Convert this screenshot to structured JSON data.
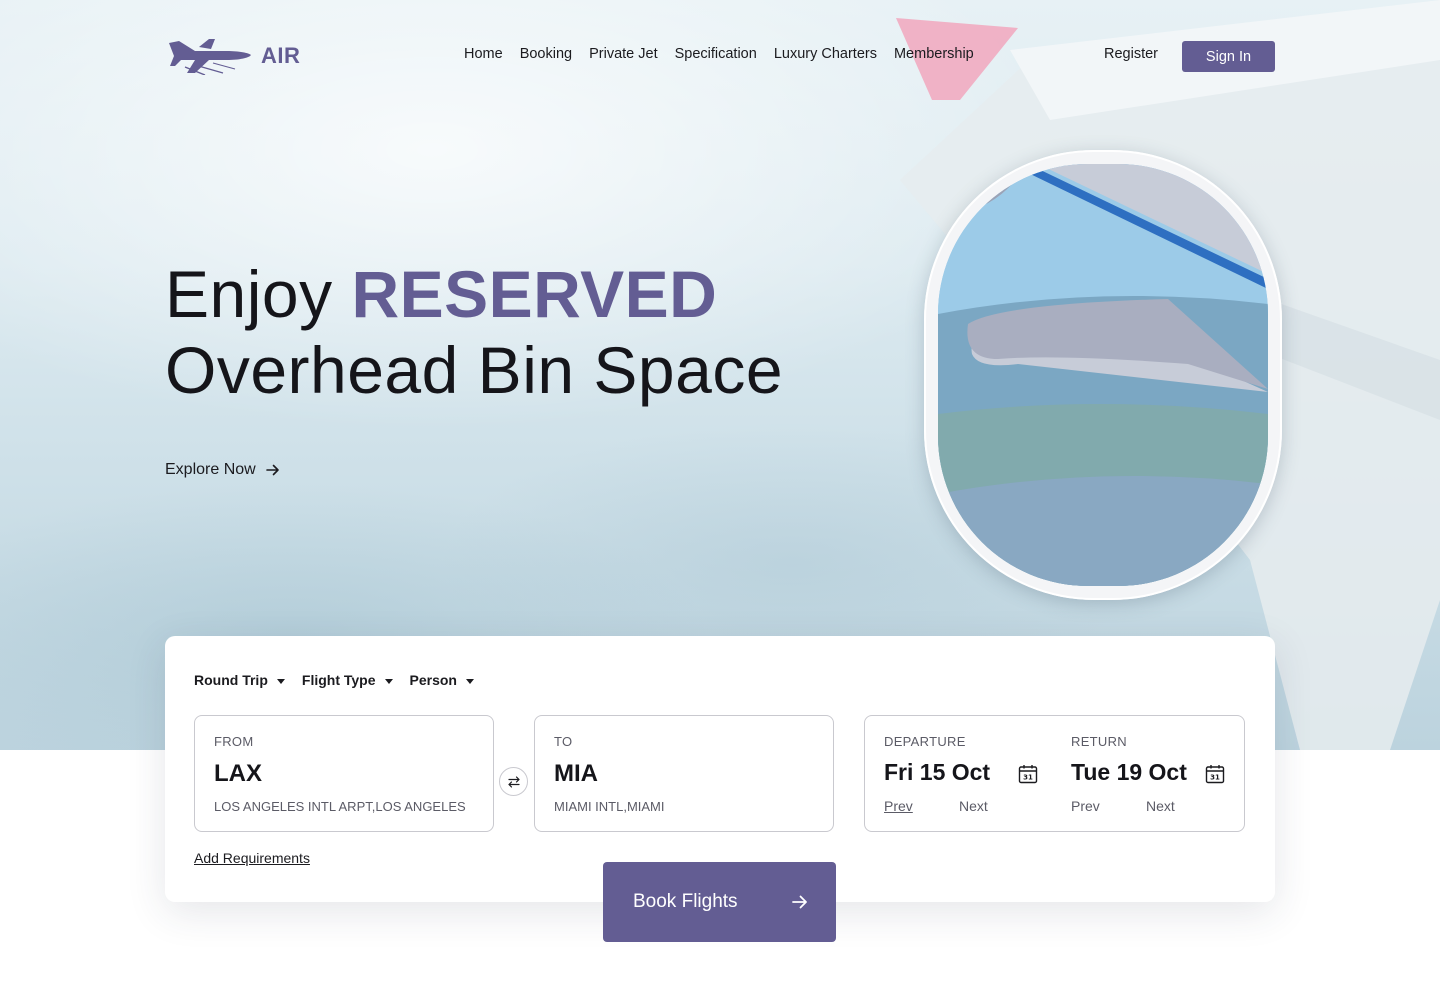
{
  "brand": {
    "name": "AIR",
    "accent": "#635d93"
  },
  "nav": {
    "items": [
      "Home",
      "Booking",
      "Private Jet",
      "Specification",
      "Luxury Charters",
      "Membership"
    ],
    "register": "Register",
    "signin": "Sign In"
  },
  "hero": {
    "headline_pre": "Enjoy ",
    "headline_accent": "RESERVED",
    "headline_line2": "Overhead Bin Space",
    "cta": "Explore Now"
  },
  "booking": {
    "selects": [
      "Round Trip",
      "Flight Type",
      "Person"
    ],
    "from": {
      "label": "FROM",
      "code": "LAX",
      "name": "LOS ANGELES INTL ARPT,LOS ANGELES"
    },
    "to": {
      "label": "TO",
      "code": "MIA",
      "name": "MIAMI INTL,MIAMI"
    },
    "departure": {
      "label": "DEPARTURE",
      "date": "Fri 15 Oct",
      "prev": "Prev",
      "next": "Next"
    },
    "return": {
      "label": "RETURN",
      "date": "Tue 19 Oct",
      "prev": "Prev",
      "next": "Next"
    },
    "calendar_day": "31",
    "add_requirements": "Add Requirements",
    "submit": "Book Flights"
  }
}
